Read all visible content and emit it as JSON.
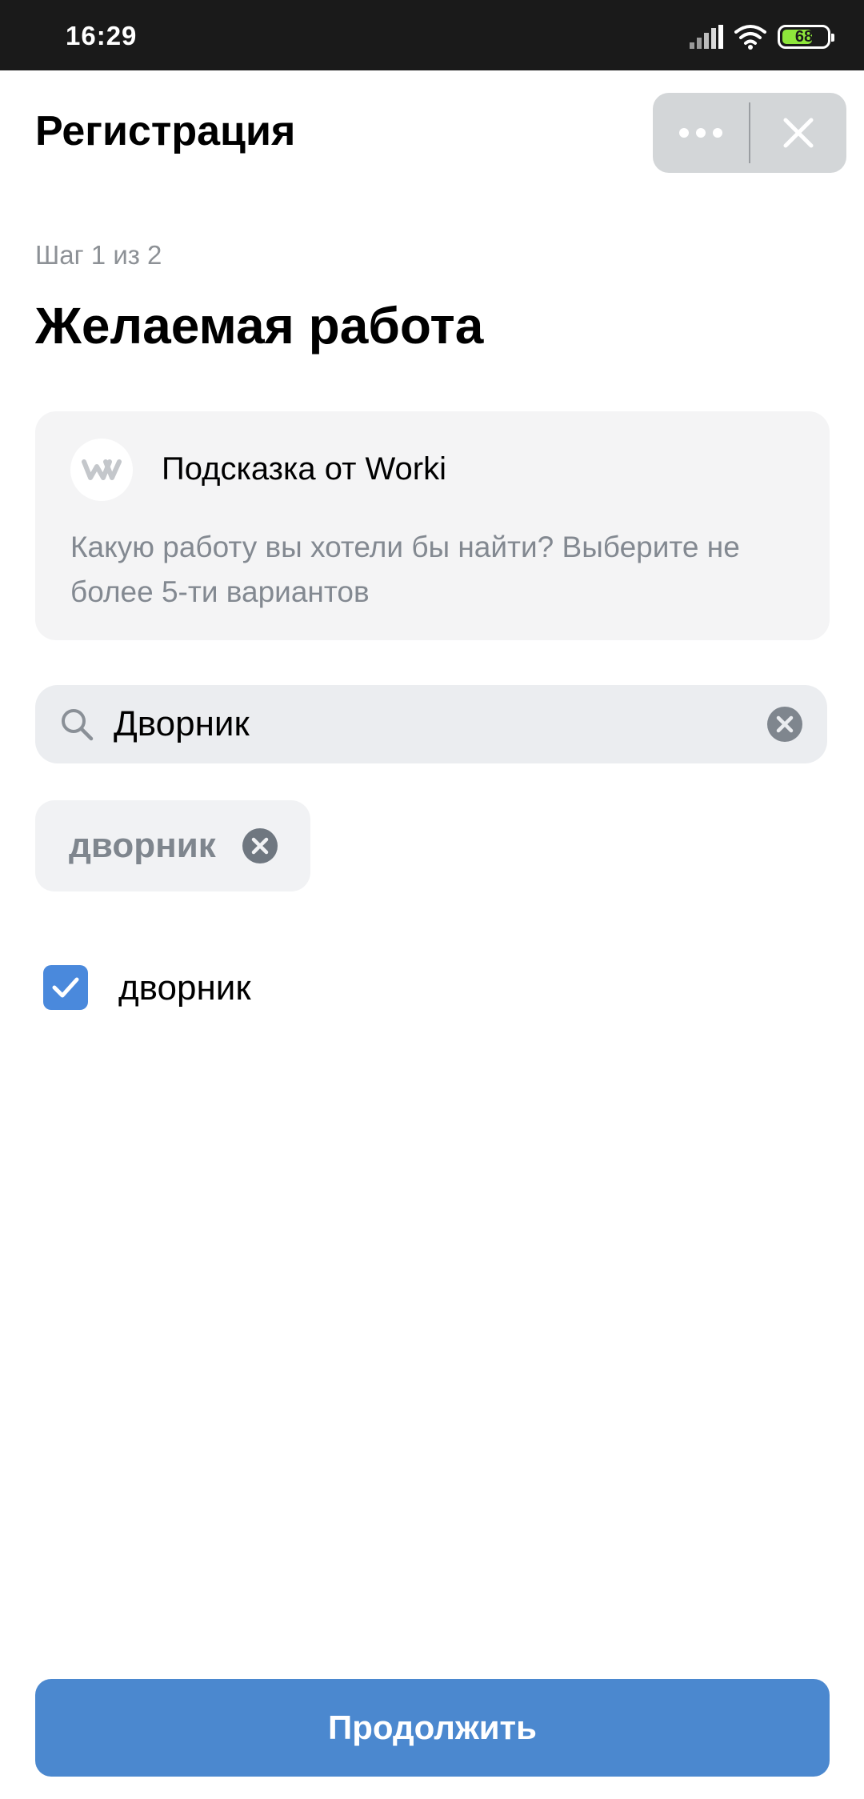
{
  "status_bar": {
    "time": "16:29",
    "battery_level": "68",
    "battery_fraction": 0.68,
    "icons": [
      "signal-icon",
      "wifi-icon",
      "battery-icon"
    ]
  },
  "header": {
    "title": "Регистрация",
    "more_icon": "more-dots-icon",
    "close_icon": "close-icon"
  },
  "step": {
    "label": "Шаг 1 из 2",
    "title": "Желаемая работа"
  },
  "hint": {
    "logo_icon": "worki-logo-icon",
    "title": "Подсказка от Worki",
    "text": "Какую работу вы хотели бы найти? Выберите не более 5-ти вариантов"
  },
  "search": {
    "value": "Дворник",
    "icon": "search-icon",
    "clear_icon": "clear-circle-icon"
  },
  "selected_chips": [
    {
      "label": "дворник"
    }
  ],
  "options": [
    {
      "label": "дворник",
      "checked": true
    }
  ],
  "footer": {
    "continue_label": "Продолжить"
  },
  "colors": {
    "accent": "#4b88cf",
    "checkbox": "#4a89dc",
    "status_bar_bg": "#1a1a1a",
    "battery_fill": "#8ee63b"
  }
}
